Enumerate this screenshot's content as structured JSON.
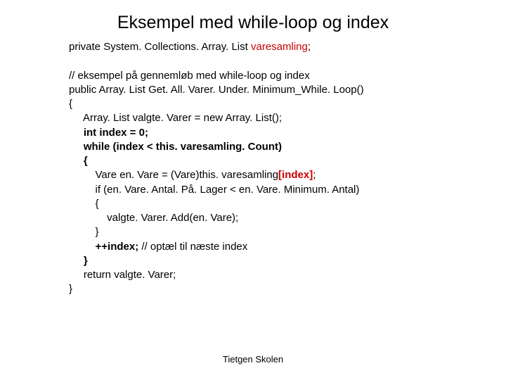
{
  "title": "Eksempel med while-loop og index",
  "footer": "Tietgen Skolen",
  "code": {
    "l0a": "private System. Collections. Array. List ",
    "l0b": "varesamling",
    "l0c": ";",
    "l1": "// eksempel på gennemløb med while-loop og index",
    "l2": "public Array. List Get. All. Varer. Under. Minimum_While. Loop()",
    "l3": "{",
    "l4": "     Array. List valgte. Varer = new Array. List();",
    "l5": "     int index = 0;",
    "l6": "     while (index < this. varesamling. Count)",
    "l7": "     {",
    "l8a": "         Vare en. Vare = (Vare)this. varesamling",
    "l8b": "[index]",
    "l8c": ";",
    "l9": "         if (en. Vare. Antal. På. Lager < en. Vare. Minimum. Antal)",
    "l10": "         {",
    "l11": "             valgte. Varer. Add(en. Vare);",
    "l12": "         }",
    "l13a": "         ++index;",
    "l13b": " // optæl til næste index",
    "l14": "     }",
    "l15": "     return valgte. Varer;",
    "l16": "}"
  }
}
